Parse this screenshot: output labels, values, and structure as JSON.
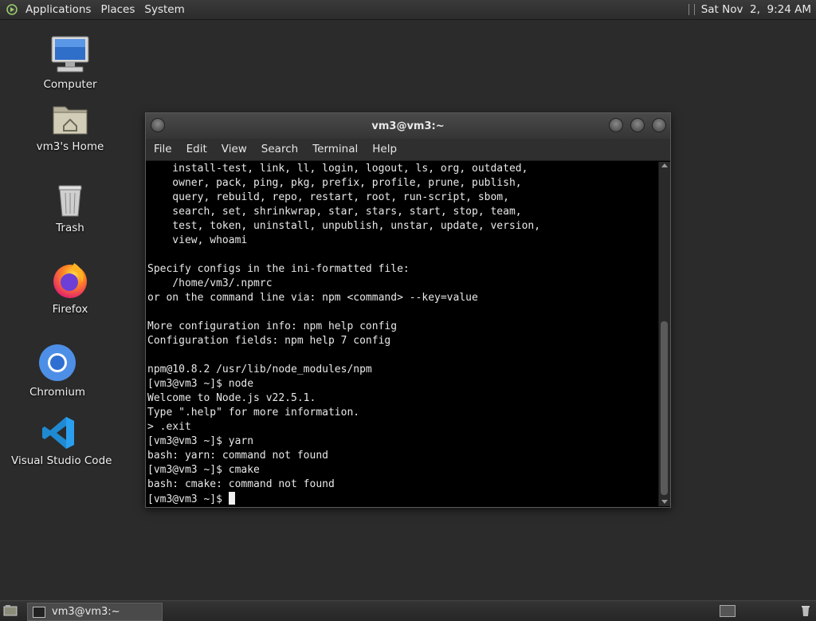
{
  "top_panel": {
    "menus": [
      "Applications",
      "Places",
      "System"
    ],
    "clock": "Sat Nov  2,  9:24 AM"
  },
  "desktop": {
    "icons": [
      "Computer",
      "vm3's Home",
      "Trash",
      "Firefox",
      "Chromium",
      "Visual Studio Code"
    ]
  },
  "terminal": {
    "title": "vm3@vm3:~",
    "menu": [
      "File",
      "Edit",
      "View",
      "Search",
      "Terminal",
      "Help"
    ],
    "lines": [
      "    install-test, link, ll, login, logout, ls, org, outdated,",
      "    owner, pack, ping, pkg, prefix, profile, prune, publish,",
      "    query, rebuild, repo, restart, root, run-script, sbom,",
      "    search, set, shrinkwrap, star, stars, start, stop, team,",
      "    test, token, uninstall, unpublish, unstar, update, version,",
      "    view, whoami",
      "",
      "Specify configs in the ini-formatted file:",
      "    /home/vm3/.npmrc",
      "or on the command line via: npm <command> --key=value",
      "",
      "More configuration info: npm help config",
      "Configuration fields: npm help 7 config",
      "",
      "npm@10.8.2 /usr/lib/node_modules/npm",
      "[vm3@vm3 ~]$ node",
      "Welcome to Node.js v22.5.1.",
      "Type \".help\" for more information.",
      "> .exit",
      "[vm3@vm3 ~]$ yarn",
      "bash: yarn: command not found",
      "[vm3@vm3 ~]$ cmake",
      "bash: cmake: command not found"
    ],
    "prompt": "[vm3@vm3 ~]$ "
  },
  "taskbar": {
    "task_label": "vm3@vm3:~"
  }
}
